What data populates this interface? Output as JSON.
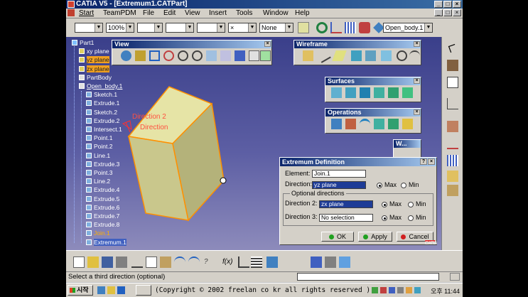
{
  "window": {
    "title": "CATIA V5 - [Extremum1.CATPart]"
  },
  "menu": [
    "Start",
    "TeamPDM",
    "File",
    "Edit",
    "View",
    "Insert",
    "Tools",
    "Window",
    "Help"
  ],
  "toolbar": {
    "zoom": "100%",
    "layer": "None",
    "body_selector": "Open_body.1"
  },
  "tree": [
    {
      "label": "Part1",
      "kind": "root"
    },
    {
      "label": "xy plane",
      "kind": "plane"
    },
    {
      "label": "yz plane",
      "kind": "plane",
      "highlight": "orange"
    },
    {
      "label": "zx plane",
      "kind": "plane",
      "highlight": "orange"
    },
    {
      "label": "PartBody",
      "kind": "body"
    },
    {
      "label": "Open_body.1",
      "kind": "body",
      "underline": true
    },
    {
      "label": "Sketch.1"
    },
    {
      "label": "Extrude.1"
    },
    {
      "label": "Sketch.2"
    },
    {
      "label": "Extrude.2"
    },
    {
      "label": "Intersect.1"
    },
    {
      "label": "Point.1"
    },
    {
      "label": "Point.2"
    },
    {
      "label": "Line.1"
    },
    {
      "label": "Extrude.3"
    },
    {
      "label": "Point.3"
    },
    {
      "label": "Line.2"
    },
    {
      "label": "Extrude.4"
    },
    {
      "label": "Extrude.5"
    },
    {
      "label": "Extrude.6"
    },
    {
      "label": "Extrude.7"
    },
    {
      "label": "Extrude.8"
    },
    {
      "label": "Join.1",
      "highlight": "selected"
    },
    {
      "label": "Extremum.1",
      "highlight": "blue"
    }
  ],
  "viewport": {
    "direction_label": "Direction 2",
    "direction_sub": "Direction"
  },
  "toolbars": {
    "view": {
      "title": "View"
    },
    "wireframe": {
      "title": "Wireframe"
    },
    "surfaces": {
      "title": "Surfaces"
    },
    "operations": {
      "title": "Operations"
    },
    "mini": {
      "title": "W..."
    }
  },
  "dialog": {
    "title": "Extremum Definition",
    "element_label": "Element:",
    "element_value": "Join.1",
    "direction_label": "Direction:",
    "direction_value": "yz plane",
    "max_label": "Max",
    "min_label": "Min",
    "optional_label": "Optional directions",
    "direction2_label": "Direction 2:",
    "direction2_value": "zx plane",
    "direction3_label": "Direction 3:",
    "direction3_value": "No selection",
    "ok_label": "OK",
    "apply_label": "Apply",
    "cancel_label": "Cancel",
    "colors": {
      "ok": "#20a020",
      "apply": "#20a020",
      "cancel": "#d02020"
    }
  },
  "status": {
    "text": "Select a third direction (optional)"
  },
  "taskbar": {
    "start_label": "시작",
    "copyright": "(Copyright © 2002 freelan co kr all rights reserved )",
    "clock": "오후 11:44"
  },
  "logo": {
    "text": "CATIA"
  }
}
